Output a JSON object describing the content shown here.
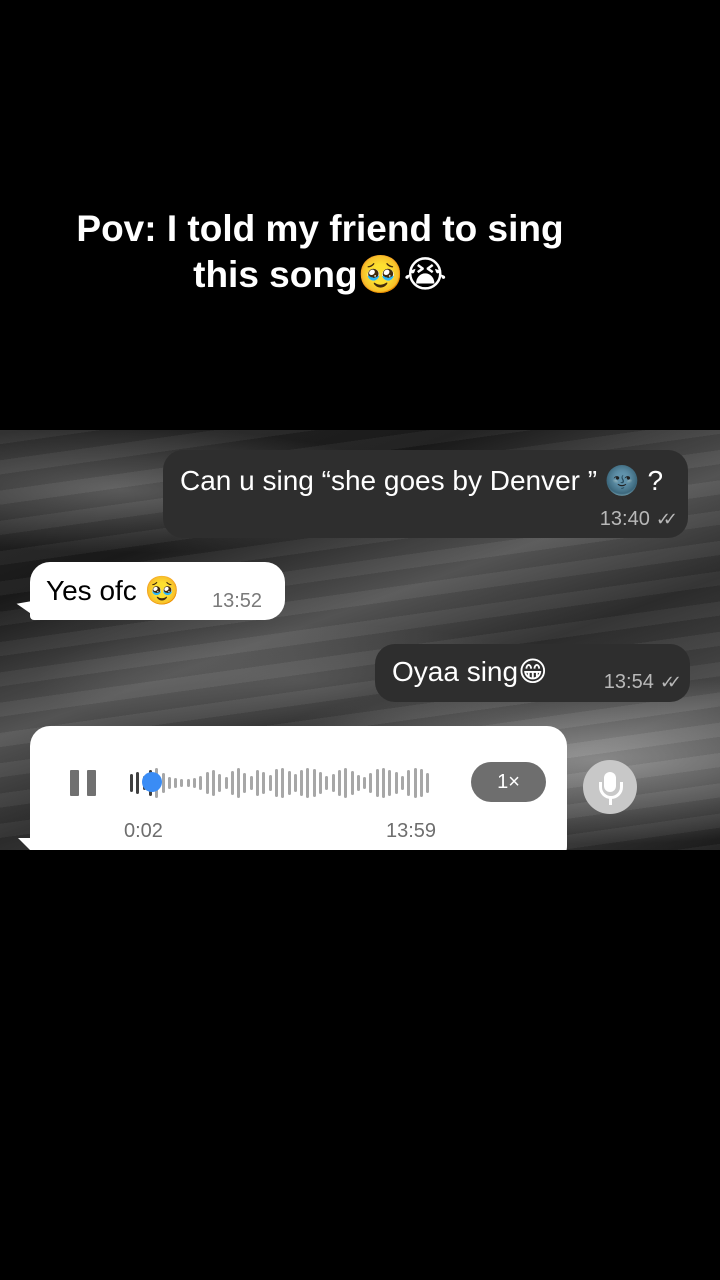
{
  "caption": {
    "line1": "Pov: I told my friend to sing",
    "line2": "this song🥹😭"
  },
  "messages": [
    {
      "direction": "outgoing",
      "text": "Can u sing “she goes by Denver ” 🌚 ?",
      "time": "13:40",
      "status": "read"
    },
    {
      "direction": "incoming",
      "text": "Yes ofc 🥹",
      "time": "13:52"
    },
    {
      "direction": "outgoing",
      "text": "Oyaa sing😁",
      "time": "13:54",
      "status": "read"
    }
  ],
  "voice_message": {
    "elapsed": "0:02",
    "time": "13:59",
    "speed": "1×",
    "progress": 0.07,
    "state": "playing"
  },
  "icons": {
    "pause": "pause-icon",
    "mic": "microphone-icon",
    "read_receipt": "double-check-icon"
  },
  "colors": {
    "outgoing_bubble": "#2e2e2e",
    "incoming_bubble": "#ffffff",
    "playhead": "#3a8cf5"
  }
}
